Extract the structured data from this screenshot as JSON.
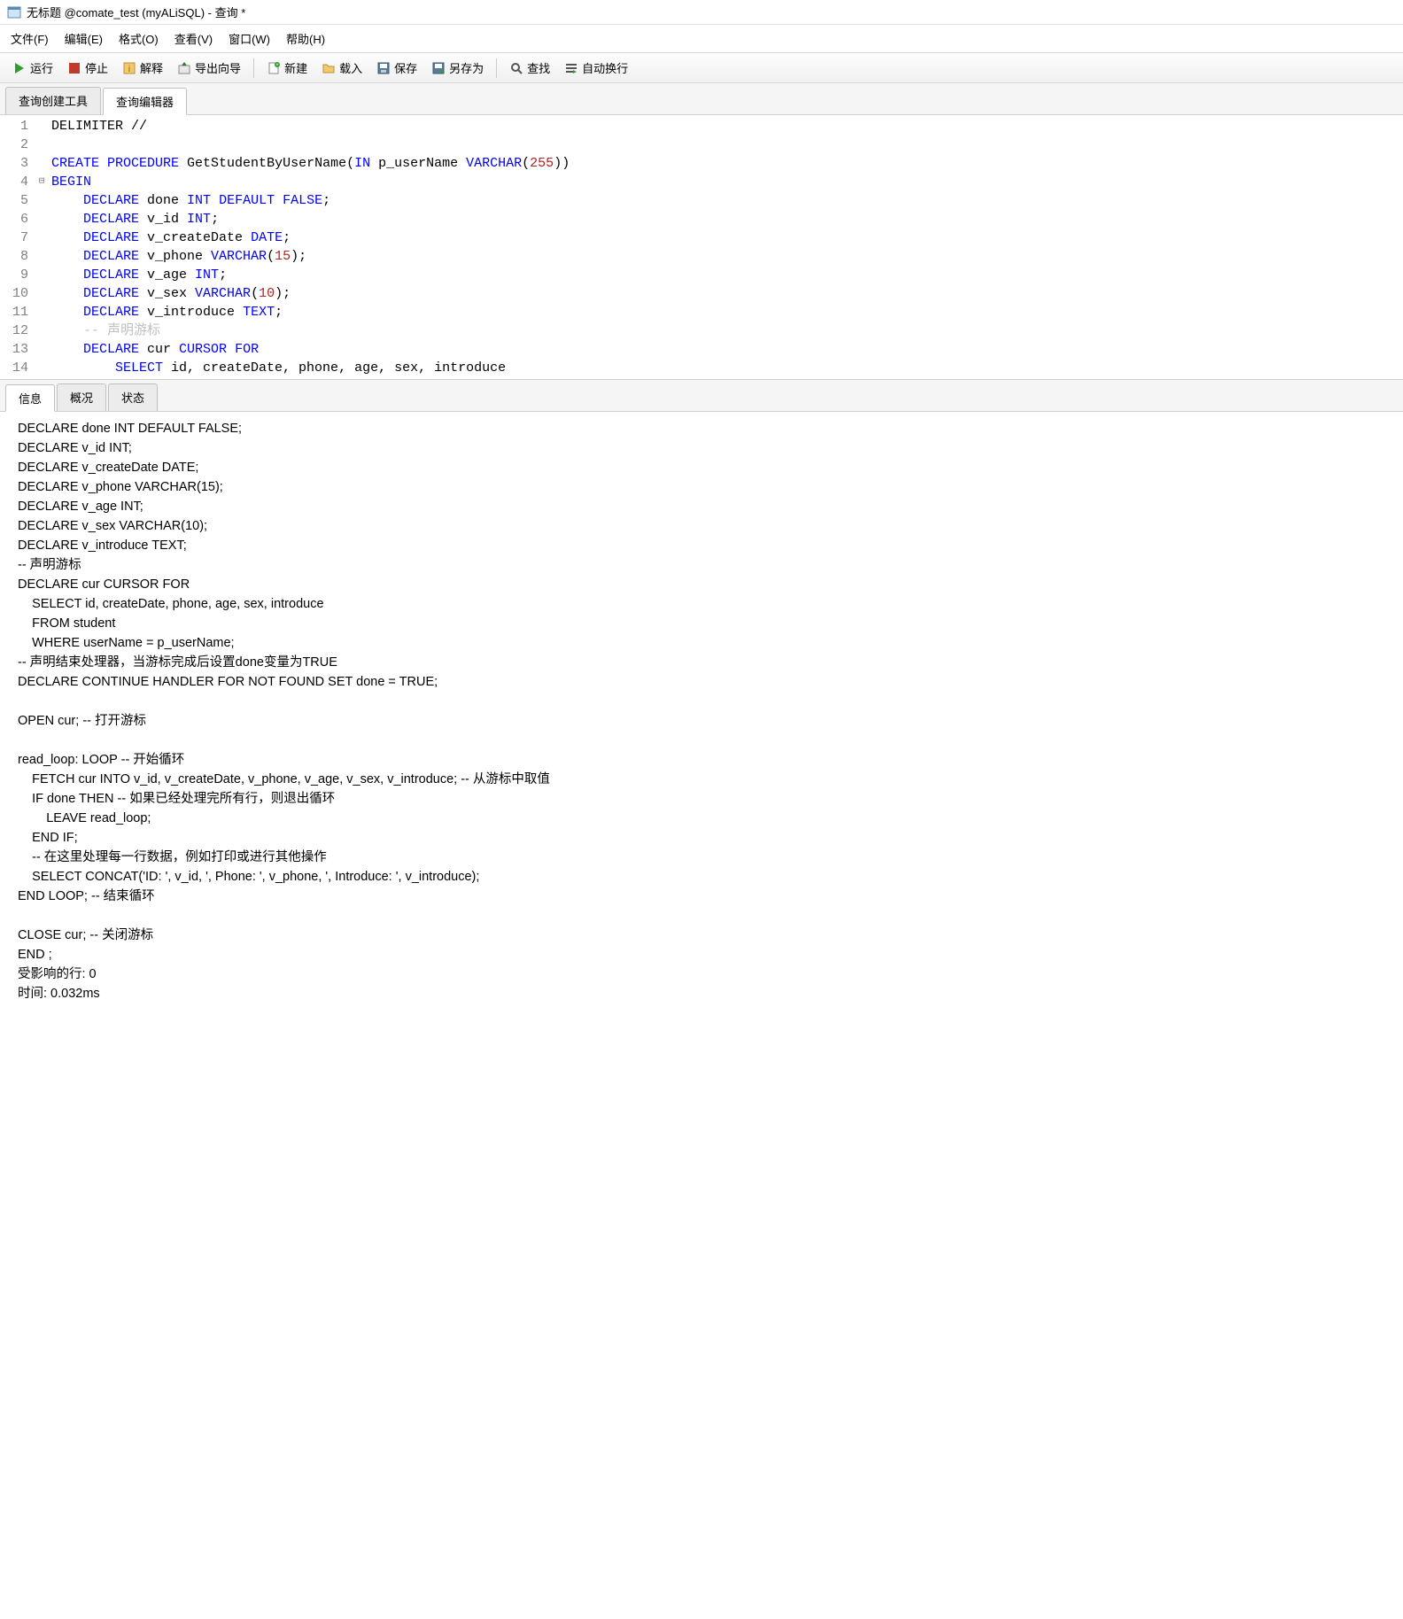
{
  "window": {
    "title": "无标题 @comate_test (myALiSQL) - 查询 *"
  },
  "menu": {
    "file": "文件(F)",
    "edit": "编辑(E)",
    "format": "格式(O)",
    "view": "查看(V)",
    "window": "窗口(W)",
    "help": "帮助(H)"
  },
  "toolbar": {
    "run": "运行",
    "stop": "停止",
    "explain": "解释",
    "export": "导出向导",
    "new": "新建",
    "load": "载入",
    "save": "保存",
    "saveas": "另存为",
    "find": "查找",
    "wrap": "自动换行"
  },
  "tabs": {
    "builder": "查询创建工具",
    "editor": "查询编辑器"
  },
  "code": {
    "lines": [
      {
        "n": "1",
        "fold": "",
        "html": "DELIMITER //"
      },
      {
        "n": "2",
        "fold": "",
        "html": ""
      },
      {
        "n": "3",
        "fold": "",
        "html": "<span class='kw'>CREATE</span> <span class='kw'>PROCEDURE</span> GetStudentByUserName(<span class='kw'>IN</span> p_userName <span class='kw'>VARCHAR</span>(<span class='num'>255</span>))"
      },
      {
        "n": "4",
        "fold": "⊟",
        "html": "<span class='kw'>BEGIN</span>"
      },
      {
        "n": "5",
        "fold": "",
        "html": "    <span class='kw'>DECLARE</span> done <span class='kw'>INT</span> <span class='kw'>DEFAULT</span> <span class='kw'>FALSE</span>;"
      },
      {
        "n": "6",
        "fold": "",
        "html": "    <span class='kw'>DECLARE</span> v_id <span class='kw'>INT</span>;"
      },
      {
        "n": "7",
        "fold": "",
        "html": "    <span class='kw'>DECLARE</span> v_createDate <span class='kw'>DATE</span>;"
      },
      {
        "n": "8",
        "fold": "",
        "html": "    <span class='kw'>DECLARE</span> v_phone <span class='kw'>VARCHAR</span>(<span class='num'>15</span>);"
      },
      {
        "n": "9",
        "fold": "",
        "html": "    <span class='kw'>DECLARE</span> v_age <span class='kw'>INT</span>;"
      },
      {
        "n": "10",
        "fold": "",
        "html": "    <span class='kw'>DECLARE</span> v_sex <span class='kw'>VARCHAR</span>(<span class='num'>10</span>);"
      },
      {
        "n": "11",
        "fold": "",
        "html": "    <span class='kw'>DECLARE</span> v_introduce <span class='kw'>TEXT</span>;"
      },
      {
        "n": "12",
        "fold": "",
        "html": "    <span class='cmt'>-- 声明游标</span>"
      },
      {
        "n": "13",
        "fold": "",
        "html": "    <span class='kw'>DECLARE</span> cur <span class='kw'>CURSOR</span> <span class='kw'>FOR</span>"
      },
      {
        "n": "14",
        "fold": "",
        "html": "        <span class='kw'>SELECT</span> id, createDate, phone, age, sex, introduce"
      }
    ]
  },
  "bottom_tabs": {
    "info": "信息",
    "profile": "概况",
    "status": "状态"
  },
  "output": "DECLARE done INT DEFAULT FALSE;\nDECLARE v_id INT;\nDECLARE v_createDate DATE;\nDECLARE v_phone VARCHAR(15);\nDECLARE v_age INT;\nDECLARE v_sex VARCHAR(10);\nDECLARE v_introduce TEXT;\n-- 声明游标\nDECLARE cur CURSOR FOR\n    SELECT id, createDate, phone, age, sex, introduce\n    FROM student\n    WHERE userName = p_userName;\n-- 声明结束处理器，当游标完成后设置done变量为TRUE\nDECLARE CONTINUE HANDLER FOR NOT FOUND SET done = TRUE;\n\nOPEN cur; -- 打开游标\n\nread_loop: LOOP -- 开始循环\n    FETCH cur INTO v_id, v_createDate, v_phone, v_age, v_sex, v_introduce; -- 从游标中取值\n    IF done THEN -- 如果已经处理完所有行，则退出循环\n        LEAVE read_loop;\n    END IF;\n    -- 在这里处理每一行数据，例如打印或进行其他操作\n    SELECT CONCAT('ID: ', v_id, ', Phone: ', v_phone, ', Introduce: ', v_introduce);\nEND LOOP; -- 结束循环\n\nCLOSE cur; -- 关闭游标\nEND ;\n受影响的行: 0\n时间: 0.032ms"
}
